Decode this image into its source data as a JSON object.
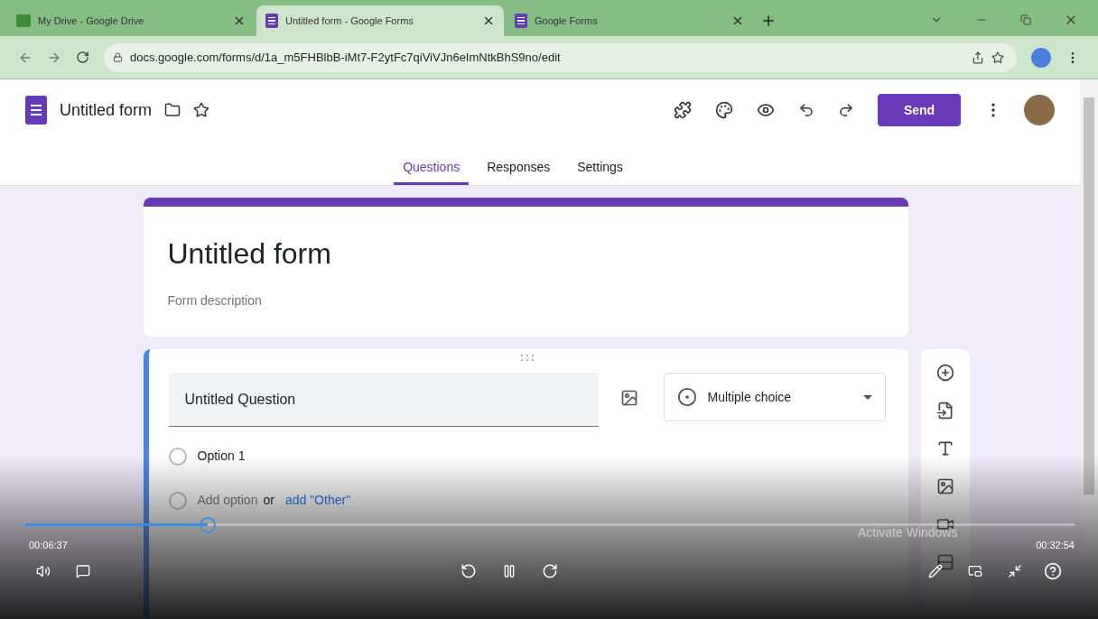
{
  "browser": {
    "tabs": [
      {
        "title": "My Drive - Google Drive",
        "selected": false
      },
      {
        "title": "Untitled form - Google Forms",
        "selected": true
      },
      {
        "title": "Google Forms",
        "selected": false
      }
    ],
    "url": "docs.google.com/forms/d/1a_m5FHBlbB-iMt7-F2ytFc7qiViVJn6eImNtkBhS9no/edit"
  },
  "header": {
    "title": "Untitled form",
    "send": "Send",
    "tabs": [
      {
        "label": "Questions",
        "selected": true
      },
      {
        "label": "Responses",
        "selected": false
      },
      {
        "label": "Settings",
        "selected": false
      }
    ]
  },
  "form": {
    "title": "Untitled form",
    "description_placeholder": "Form description"
  },
  "question": {
    "title": "Untitled Question",
    "type": "Multiple choice",
    "options": [
      "Option 1"
    ],
    "add_option": "Add option",
    "or": "or",
    "add_other": "add \"Other\""
  },
  "video": {
    "elapsed": "00:06:37",
    "total": "00:32:54",
    "level": 0.174,
    "playing": true
  },
  "os_notice": "Activate Windows"
}
